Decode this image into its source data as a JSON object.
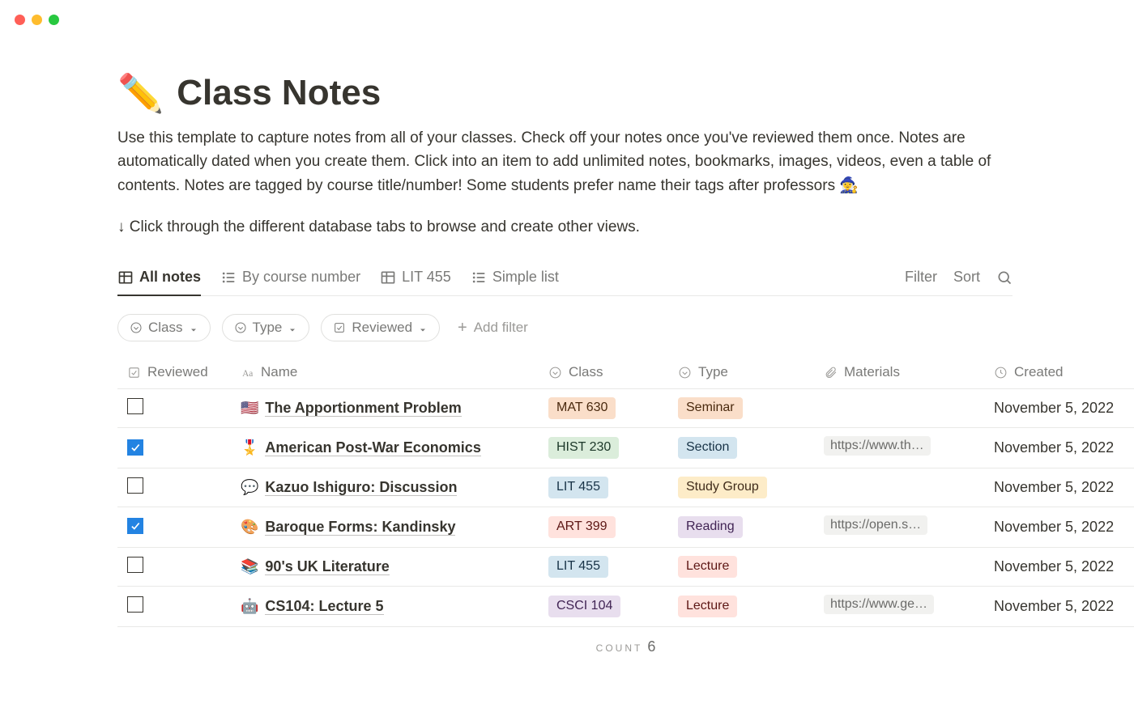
{
  "page": {
    "icon": "✏️",
    "title": "Class Notes",
    "description": "Use this template to capture notes from all of your classes. Check off your notes once you've reviewed them once. Notes are automatically dated when you create them. Click into an item to add unlimited notes, bookmarks, images, videos, even a table of contents. Notes are tagged by course title/number!  Some students prefer name their tags after professors 🧙‍♀️",
    "hint": "↓ Click through the different database tabs to browse and create other views."
  },
  "tabs": [
    {
      "label": "All notes",
      "icon": "table",
      "active": true
    },
    {
      "label": "By course number",
      "icon": "list",
      "active": false
    },
    {
      "label": "LIT 455",
      "icon": "table",
      "active": false
    },
    {
      "label": "Simple list",
      "icon": "list",
      "active": false
    }
  ],
  "toolbar": {
    "filter": "Filter",
    "sort": "Sort"
  },
  "filters": {
    "pills": [
      {
        "label": "Class",
        "icon": "select"
      },
      {
        "label": "Type",
        "icon": "select"
      },
      {
        "label": "Reviewed",
        "icon": "checkbox"
      }
    ],
    "add": "Add filter"
  },
  "columns": [
    {
      "label": "Reviewed",
      "icon": "checkbox"
    },
    {
      "label": "Name",
      "icon": "text"
    },
    {
      "label": "Class",
      "icon": "select"
    },
    {
      "label": "Type",
      "icon": "select"
    },
    {
      "label": "Materials",
      "icon": "attachment"
    },
    {
      "label": "Created",
      "icon": "clock"
    }
  ],
  "tag_colors": {
    "MAT 630": {
      "bg": "#fadec9",
      "fg": "#49290e"
    },
    "HIST 230": {
      "bg": "#dbeddb",
      "fg": "#1c3829"
    },
    "LIT 455": {
      "bg": "#d3e5ef",
      "fg": "#183347"
    },
    "ART 399": {
      "bg": "#ffe2dd",
      "fg": "#5d1715"
    },
    "CSCI 104": {
      "bg": "#e8deee",
      "fg": "#412454"
    },
    "Seminar": {
      "bg": "#fadec9",
      "fg": "#49290e"
    },
    "Section": {
      "bg": "#d3e5ef",
      "fg": "#183347"
    },
    "Study Group": {
      "bg": "#fdecc8",
      "fg": "#402c1b"
    },
    "Reading": {
      "bg": "#e8deee",
      "fg": "#412454"
    },
    "Lecture": {
      "bg": "#ffe2dd",
      "fg": "#5d1715"
    }
  },
  "rows": [
    {
      "reviewed": false,
      "icon": "🇺🇸",
      "name": "The Apportionment Problem",
      "class": "MAT 630",
      "type": "Seminar",
      "materials": "",
      "created": "November 5, 2022"
    },
    {
      "reviewed": true,
      "icon": "🎖️",
      "name": "American Post-War Economics",
      "class": "HIST 230",
      "type": "Section",
      "materials": "https://www.th…",
      "created": "November 5, 2022"
    },
    {
      "reviewed": false,
      "icon": "💬",
      "name": "Kazuo Ishiguro: Discussion",
      "class": "LIT 455",
      "type": "Study Group",
      "materials": "",
      "created": "November 5, 2022"
    },
    {
      "reviewed": true,
      "icon": "🎨",
      "name": "Baroque Forms: Kandinsky",
      "class": "ART 399",
      "type": "Reading",
      "materials": "https://open.s…",
      "created": "November 5, 2022"
    },
    {
      "reviewed": false,
      "icon": "📚",
      "name": "90's UK Literature",
      "class": "LIT 455",
      "type": "Lecture",
      "materials": "",
      "created": "November 5, 2022"
    },
    {
      "reviewed": false,
      "icon": "🤖",
      "name": "CS104: Lecture 5",
      "class": "CSCI 104",
      "type": "Lecture",
      "materials": "https://www.ge…",
      "created": "November 5, 2022"
    }
  ],
  "footer": {
    "count_label": "COUNT",
    "count_value": "6"
  }
}
